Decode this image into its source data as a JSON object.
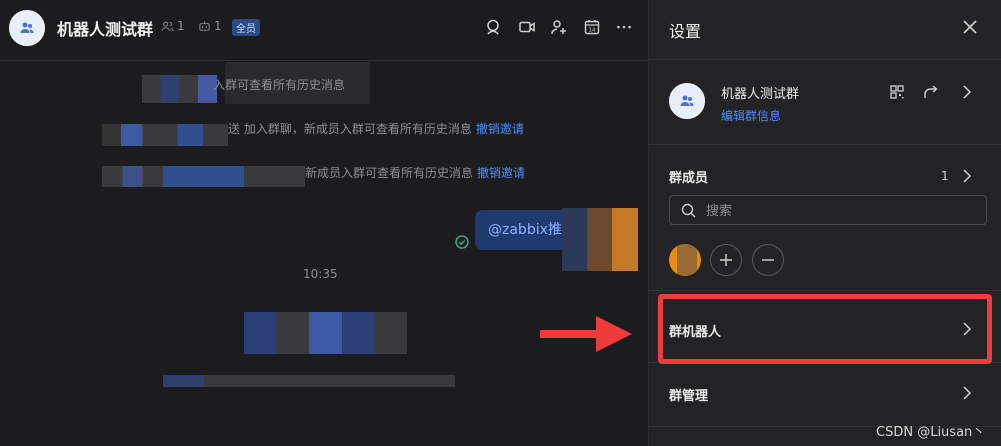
{
  "chat": {
    "title": "机器人测试群",
    "member_count": "1",
    "bot_count": "1",
    "badge": "全员",
    "system_messages": [
      {
        "text": "入群可查看所有历史消息"
      },
      {
        "text": "送 加入群聊，新成员入群可查看所有历史消息",
        "action": "撤销邀请"
      },
      {
        "text": "新成员入群可查看所有历史消息",
        "action": "撤销邀请"
      }
    ],
    "sent_message": "@zabbix推送",
    "time": "10:35"
  },
  "settings": {
    "title": "设置",
    "group_name": "机器人测试群",
    "edit_link": "编辑群信息",
    "members_label": "群成员",
    "members_count": "1",
    "search_placeholder": "搜索",
    "bot_label": "群机器人",
    "manage_label": "群管理"
  },
  "watermark": "CSDN @Liusan丶",
  "colors": {
    "accent": "#4c8dff",
    "highlight": "#ee3b3b",
    "badge_bg": "#2b4a86",
    "bubble_bg": "#1f3a6e"
  }
}
